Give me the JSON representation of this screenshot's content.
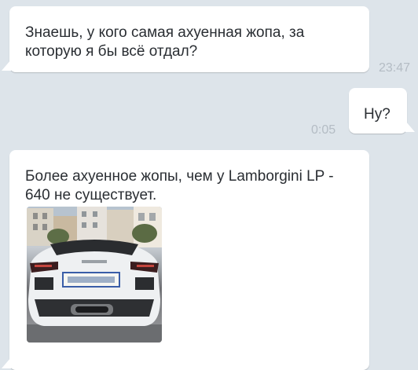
{
  "messages": [
    {
      "direction": "in",
      "text": "Знаешь, у кого самая ахуенная жопа, за которую я бы всё отдал?",
      "time": "23:47"
    },
    {
      "direction": "out",
      "text": "Ну?",
      "time": "0:05"
    },
    {
      "direction": "in",
      "text": "Более ахуенное жопы, чем у Lamborgini LP - 640 не существует.",
      "attachment": "photo"
    }
  ],
  "colors": {
    "background": "#dde4ea",
    "bubble": "#ffffff",
    "text": "#2a2e33",
    "timestamp": "#b4bcc4"
  }
}
